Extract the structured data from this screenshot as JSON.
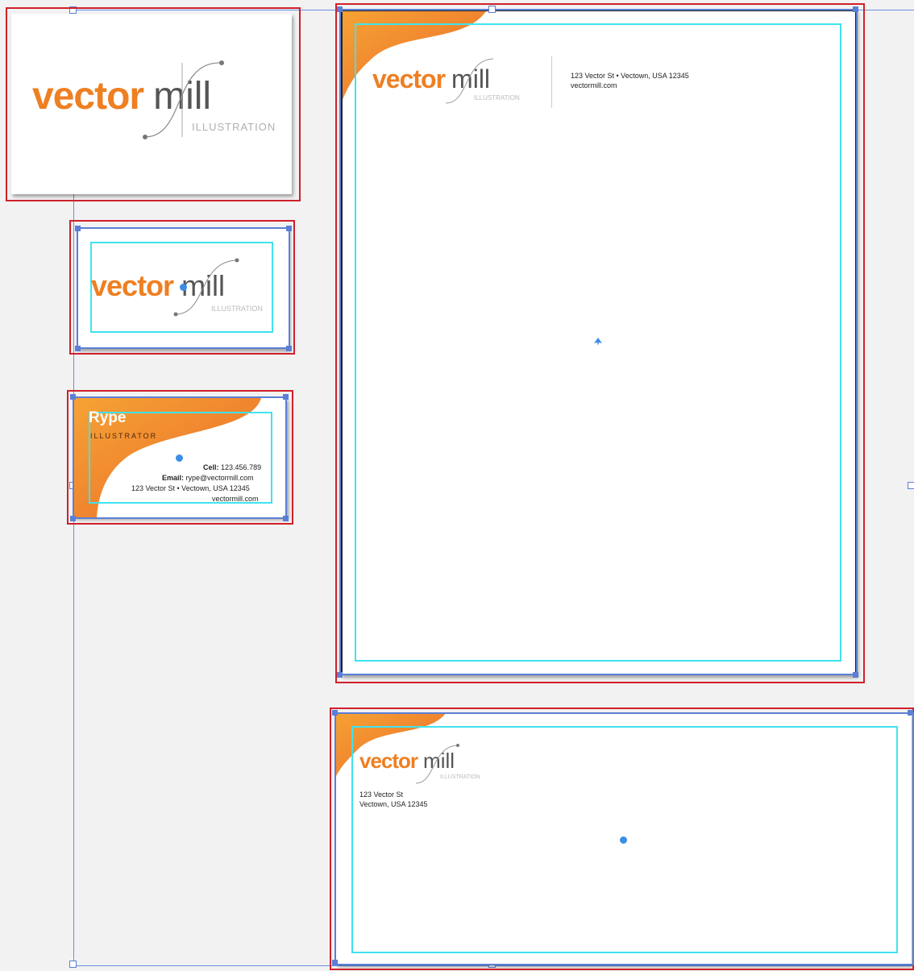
{
  "logo": {
    "word1": "vector",
    "word2": "mill",
    "tagline": "ILLUSTRATION"
  },
  "letterhead": {
    "address": "123 Vector St • Vectown, USA 12345",
    "website": "vectormill.com"
  },
  "business_card": {
    "name": "Rype",
    "title": "ILLUSTRATOR",
    "cell_label": "Cell:",
    "cell": "123.456.789",
    "email_label": "Email:",
    "email": "rype@vectormill.com",
    "address": "123 Vector St • Vectown, USA 12345",
    "website": "vectormill.com"
  },
  "envelope": {
    "line1": "123 Vector St",
    "line2": "Vectown, USA 12345"
  },
  "colors": {
    "brand_orange": "#ee7f22",
    "selection_red": "#d0202a",
    "selection_blue": "#5b7fd6",
    "margin_cyan": "#3fe3ee"
  }
}
